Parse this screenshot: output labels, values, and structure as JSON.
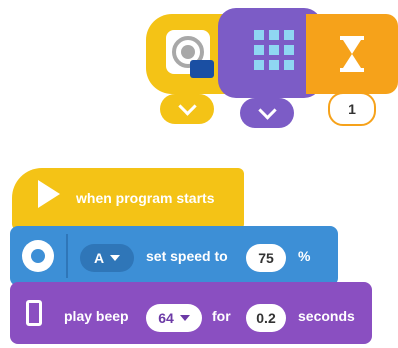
{
  "blocks_top": {
    "value_1": "1"
  },
  "stack": {
    "hat_label": "when program starts",
    "motor": {
      "port": "A",
      "text": "set speed to",
      "speed": "75",
      "unit": "%"
    },
    "sound": {
      "text": "play beep",
      "note": "64",
      "for_label": "for",
      "duration": "0.2",
      "unit": "seconds"
    }
  },
  "colors": {
    "yellow": "#f4c316",
    "purple": "#7c5cc6",
    "orange": "#f6a21a",
    "blue": "#3d8fd6",
    "sound_purple": "#8a4fc1"
  }
}
